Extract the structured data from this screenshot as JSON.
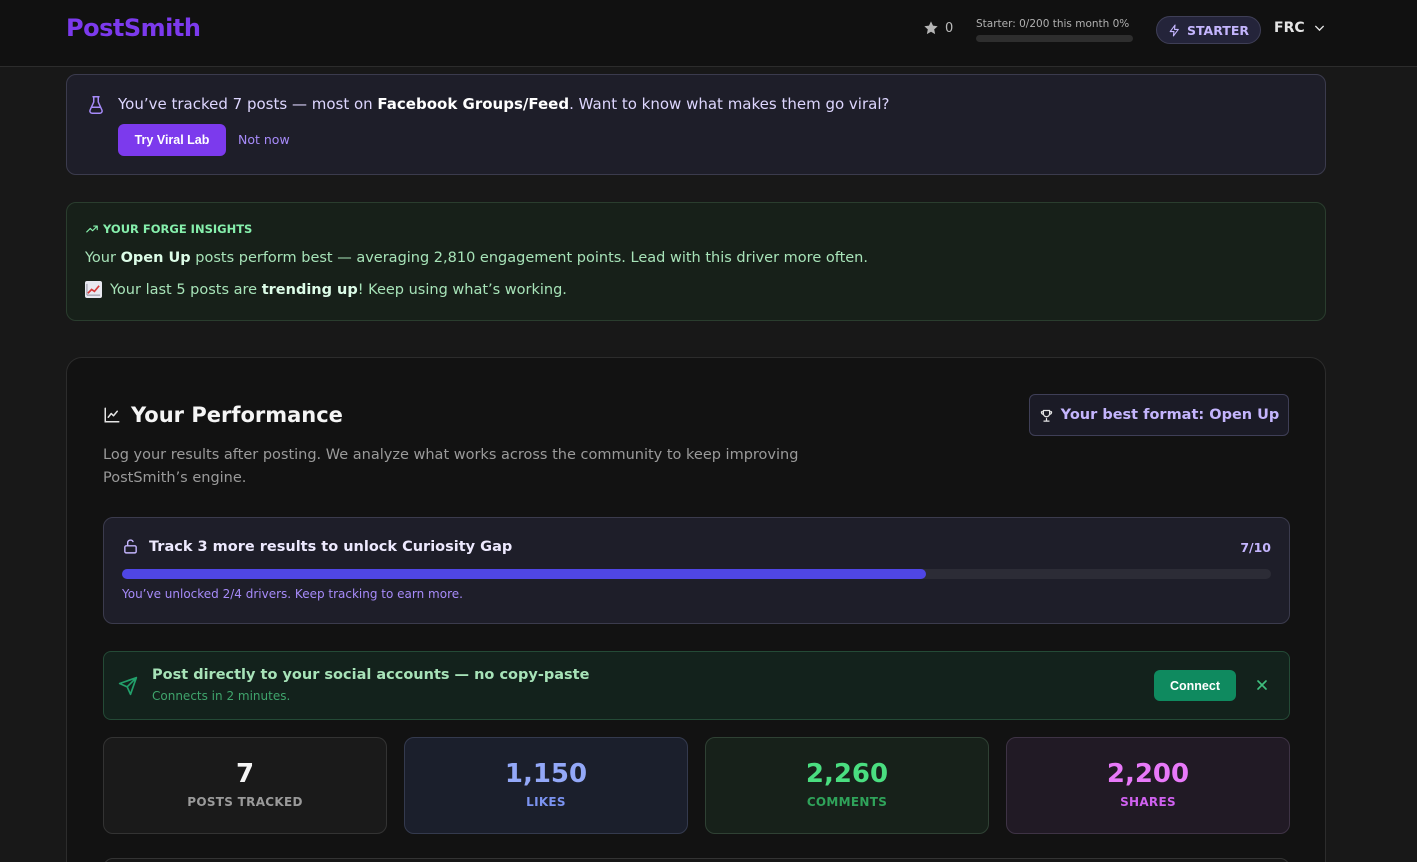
{
  "header": {
    "logo": "PostSmith",
    "star_count": "0",
    "usage_text": "Starter: 0/200 this month 0%",
    "usage_percent": 0,
    "plan_badge": "STARTER",
    "user_initials": "FRC"
  },
  "viral_banner": {
    "text_prefix": "You’ve tracked 7 posts — most on ",
    "platform": "Facebook Groups/Feed",
    "text_suffix": ". Want to know what makes them go viral?",
    "try_button": "Try Viral Lab",
    "dismiss_link": "Not now"
  },
  "insights": {
    "heading": "YOUR FORGE INSIGHTS",
    "line1_prefix": "Your ",
    "line1_driver": "Open Up",
    "line1_suffix": " posts perform best — averaging 2,810 engagement points. Lead with this driver more often.",
    "line2_prefix": "Your last 5 posts are ",
    "line2_bold": "trending up",
    "line2_suffix": "! Keep using what’s working."
  },
  "performance": {
    "title": "Your Performance",
    "best_format_button": "Your best format: Open Up",
    "description": "Log your results after posting. We analyze what works across the community to keep improving PostSmith’s engine.",
    "unlock": {
      "title": "Track 3 more results to unlock Curiosity Gap",
      "count": "7/10",
      "progress_percent": 70,
      "subtitle": "You’ve unlocked 2/4 drivers. Keep tracking to earn more."
    },
    "connect": {
      "title": "Post directly to your social accounts — no copy-paste",
      "subtitle": "Connects in 2 minutes.",
      "button": "Connect"
    },
    "stats": [
      {
        "value": "7",
        "label": "POSTS TRACKED"
      },
      {
        "value": "1,150",
        "label": "LIKES"
      },
      {
        "value": "2,260",
        "label": "COMMENTS"
      },
      {
        "value": "2,200",
        "label": "SHARES"
      }
    ]
  },
  "colors": {
    "brand": "#7c3aed",
    "progress": "#4f46e5",
    "connect": "#0f8a5f"
  }
}
